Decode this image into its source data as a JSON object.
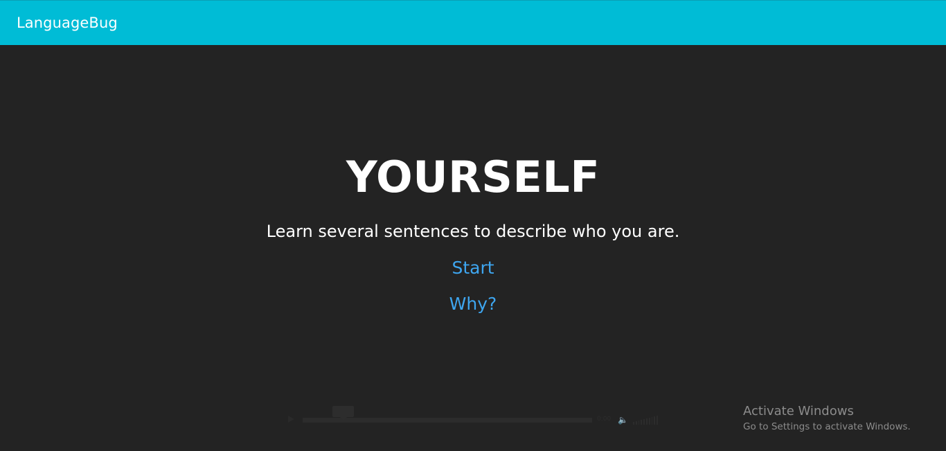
{
  "app_bar": {
    "title": "LanguageBug",
    "color": "#00bcd6"
  },
  "hero": {
    "title": "YOURSELF",
    "subtitle": "Learn several sentences to describe who you are.",
    "start_label": "Start",
    "why_label": "Why?",
    "link_color": "#3ea6f0",
    "background": "#232323"
  },
  "audio_player": {
    "play_icon": "play-icon",
    "time": "0:00",
    "volume_icon": "speaker-icon"
  },
  "watermark": {
    "title": "Activate Windows",
    "subtitle": "Go to Settings to activate Windows."
  }
}
